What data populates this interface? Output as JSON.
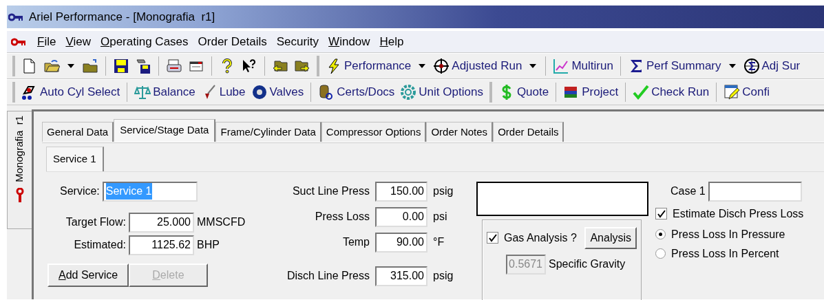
{
  "window": {
    "title": "Ariel Performance - [Monografia  r1]"
  },
  "menu": [
    {
      "label": "File",
      "first_letter_underlined": true
    },
    {
      "label": "View",
      "first_letter_underlined": true
    },
    {
      "label": "Operating Cases",
      "first_letter_underlined": true
    },
    {
      "label": "Order Details",
      "first_letter_underlined": false
    },
    {
      "label": "Security",
      "first_letter_underlined": false
    },
    {
      "label": "Window",
      "first_letter_underlined": true
    },
    {
      "label": "Help",
      "first_letter_underlined": true
    }
  ],
  "toolbar_1": {
    "buttons": [
      {
        "label": "Performance",
        "dropdown": true
      },
      {
        "label": "Adjusted Run",
        "dropdown": true
      },
      {
        "label": "Multirun",
        "dropdown": false
      },
      {
        "label": "Perf Summary",
        "dropdown": true
      },
      {
        "label": "Adj Sur",
        "dropdown": false
      }
    ]
  },
  "toolbar_2": {
    "buttons": [
      {
        "label": "Auto Cyl Select"
      },
      {
        "label": "Balance"
      },
      {
        "label": "Lube"
      },
      {
        "label": "Valves"
      },
      {
        "label": "Certs/Docs"
      },
      {
        "label": "Unit Options"
      },
      {
        "label": "Quote"
      },
      {
        "label": "Project"
      },
      {
        "label": "Check Run"
      },
      {
        "label": "Confi"
      }
    ]
  },
  "document_tab": {
    "label": "Monografia  r1"
  },
  "tabs": [
    {
      "label": "General Data",
      "selected": false
    },
    {
      "label": "Service/Stage Data",
      "selected": true
    },
    {
      "label": "Frame/Cylinder Data",
      "selected": false
    },
    {
      "label": "Compressor Options",
      "selected": false
    },
    {
      "label": "Order Notes",
      "selected": false
    },
    {
      "label": "Order Details",
      "selected": false
    }
  ],
  "subtabs": [
    {
      "label": "Service 1",
      "selected": true
    }
  ],
  "service": {
    "label": "Service:",
    "value": "Service 1",
    "text_selected": true
  },
  "flow_fields": [
    {
      "label": "Target Flow:",
      "value": "25.000",
      "unit": "MMSCFD"
    },
    {
      "label": "Estimated:",
      "value": "1125.62",
      "unit": "BHP"
    }
  ],
  "service_buttons": [
    {
      "label": "Add Service",
      "first_letter_underlined": true,
      "disabled": false
    },
    {
      "label": "Delete",
      "first_letter_underlined": true,
      "disabled": true
    }
  ],
  "pressure_fields": [
    {
      "label": "Suct Line Press",
      "value": "150.00",
      "unit": "psig"
    },
    {
      "label": "Press Loss",
      "value": "0.00",
      "unit": "psi"
    },
    {
      "label": "Temp",
      "value": "90.00",
      "unit": "°F"
    },
    {
      "label": "Disch Line Press",
      "value": "315.00",
      "unit": "psig"
    }
  ],
  "gas_analysis": {
    "label": "Gas Analysis ?",
    "checked": true,
    "button": "Analysis",
    "gravity": {
      "value": "0.5671",
      "disabled": true,
      "label": "Specific Gravity"
    }
  },
  "case": {
    "label": "Case 1"
  },
  "estimate_loss": {
    "label": "Estimate Disch Press Loss",
    "checked": true
  },
  "loss_mode": [
    {
      "label": "Press Loss In Pressure",
      "selected": true
    },
    {
      "label": "Press Loss In Percent",
      "selected": false
    }
  ]
}
